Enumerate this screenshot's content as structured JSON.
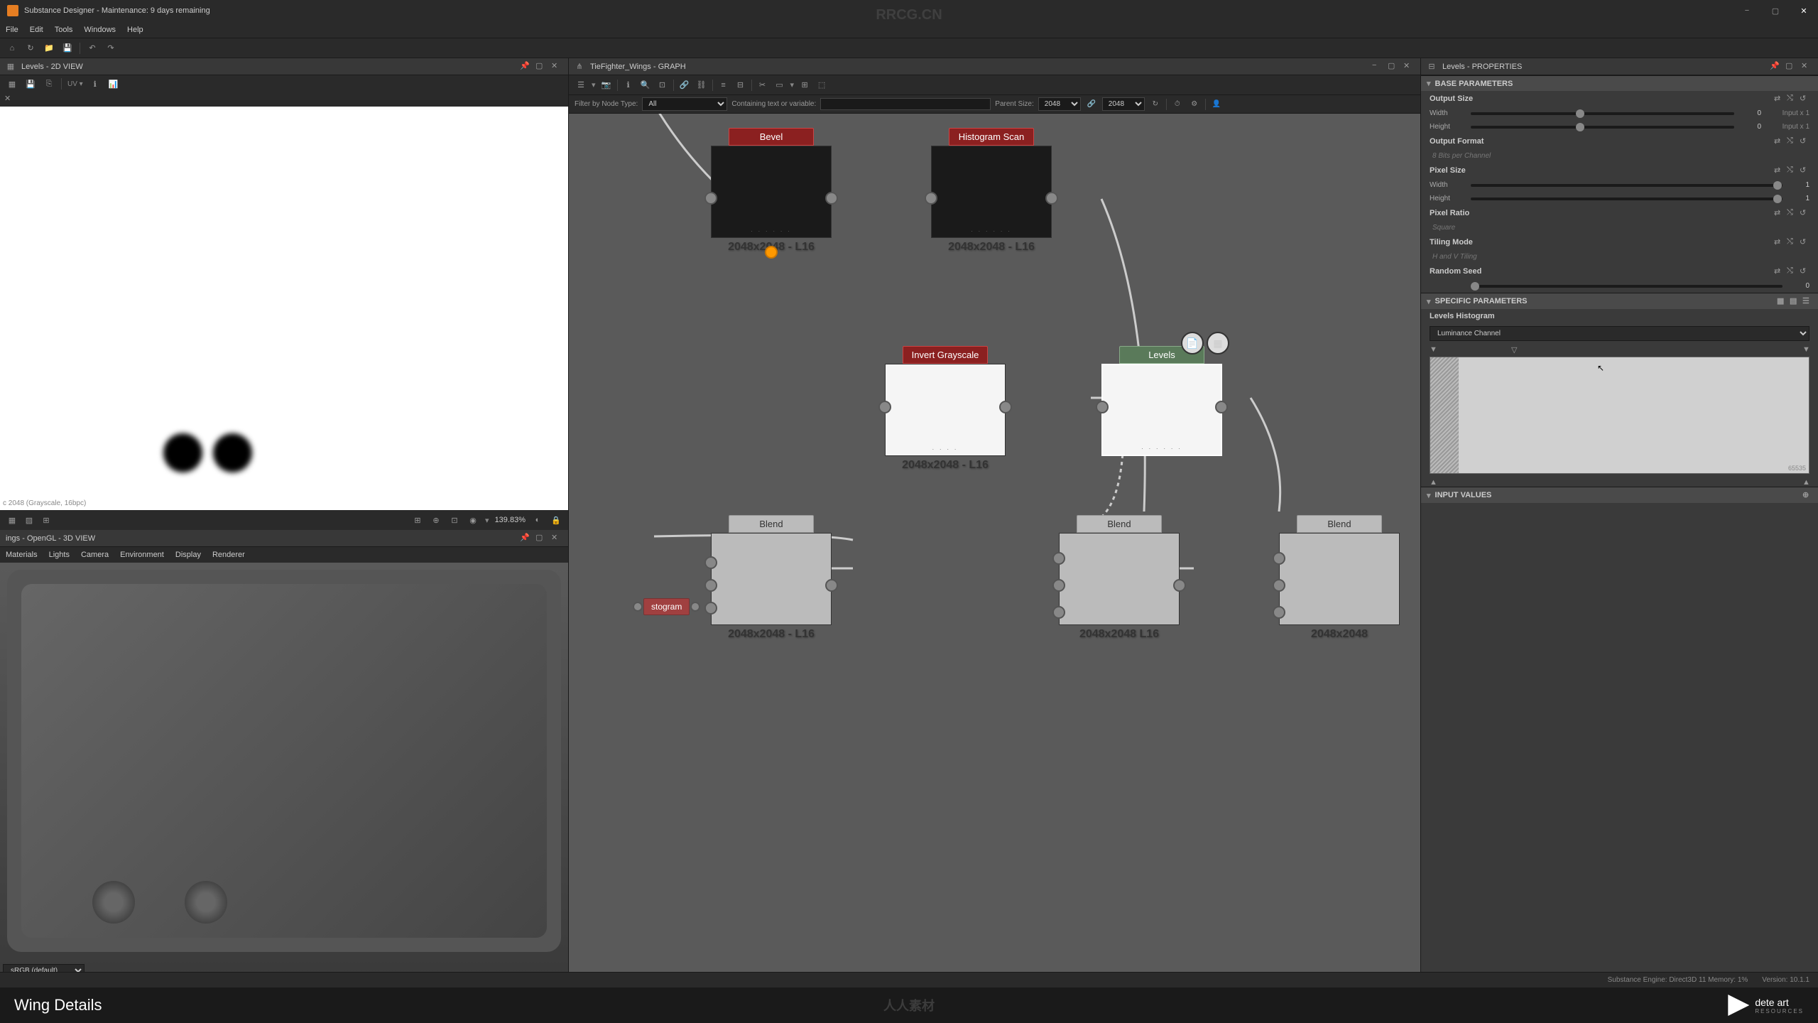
{
  "window": {
    "title": "Substance Designer - Maintenance: 9 days remaining"
  },
  "menu": {
    "items": [
      "File",
      "Edit",
      "Tools",
      "Windows",
      "Help"
    ]
  },
  "panels": {
    "view2d": {
      "title": "Levels - 2D VIEW",
      "info": "c 2048 (Grayscale, 16bpc)",
      "zoom": "139.83%"
    },
    "view3d": {
      "title": "ings - OpenGL - 3D VIEW",
      "menu": [
        "Materials",
        "Lights",
        "Camera",
        "Environment",
        "Display",
        "Renderer"
      ],
      "colorspace": "sRGB (default)"
    },
    "graph": {
      "title": "TieFighter_Wings - GRAPH",
      "filterLabel": "Filter by Node Type:",
      "filterValue": "All",
      "containingLabel": "Containing text or variable:",
      "parentSizeLabel": "Parent Size:",
      "parentSize": "2048",
      "size": "2048"
    },
    "properties": {
      "title": "Levels - PROPERTIES"
    }
  },
  "nodes": {
    "bevel": {
      "name": "Bevel",
      "res": "2048x2048 - L16"
    },
    "histScan": {
      "name": "Histogram Scan",
      "res": "2048x2048 - L16"
    },
    "invert": {
      "name": "Invert Grayscale",
      "res": "2048x2048 - L16"
    },
    "levels": {
      "name": "Levels",
      "res": ""
    },
    "blend1": {
      "name": "Blend",
      "res": "2048x2048 - L16"
    },
    "blend2": {
      "name": "Blend",
      "res": "2048x2048   L16"
    },
    "blend3": {
      "name": "Blend",
      "res": "2048x2048"
    },
    "stogram": {
      "name": "stogram"
    }
  },
  "properties": {
    "baseParameters": "BASE PARAMETERS",
    "outputSize": "Output Size",
    "width": "Width",
    "height": "Height",
    "widthValue": "0",
    "heightValue": "0",
    "inputX1": "Input x 1",
    "outputFormat": "Output Format",
    "outputFormatValue": "8 Bits per Channel",
    "pixelSize": "Pixel Size",
    "pixelWidthValue": "1",
    "pixelHeightValue": "1",
    "pixelRatio": "Pixel Ratio",
    "pixelRatioValue": "Square",
    "tilingMode": "Tiling Mode",
    "tilingModeValue": "H and V Tiling",
    "randomSeed": "Random Seed",
    "randomSeedValue": "0",
    "specificParameters": "SPECIFIC PARAMETERS",
    "levelsHistogram": "Levels Histogram",
    "luminanceChannel": "Luminance Channel",
    "histoMax": "65535",
    "inputValues": "INPUT VALUES"
  },
  "statusBar": {
    "engine": "Substance Engine: Direct3D 11  Memory: 1%",
    "version": "Version: 10.1.1"
  },
  "bottom": {
    "title": "Wing Details",
    "logoText": "dete art",
    "logoSub": "RESOURCES"
  },
  "watermarks": {
    "top": "RRCG.CN",
    "center": "人人素材"
  }
}
